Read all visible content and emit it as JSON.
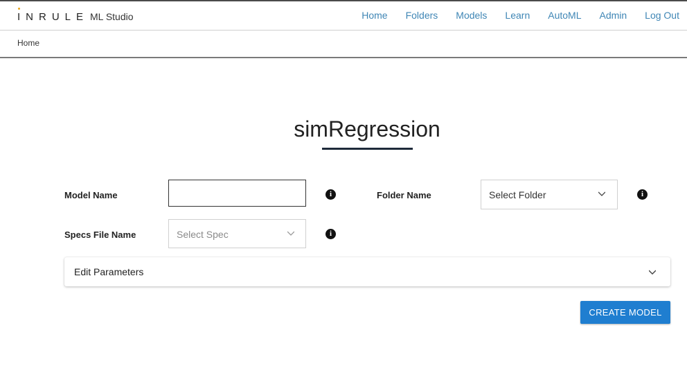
{
  "header": {
    "logo_mark": "INRULE",
    "logo_sub": "ML Studio",
    "nav": [
      "Home",
      "Folders",
      "Models",
      "Learn",
      "AutoML",
      "Admin",
      "Log Out"
    ],
    "nav_color": "#3f86b5",
    "logo_dot_color": "#e8a317"
  },
  "breadcrumb": {
    "home": "Home"
  },
  "page": {
    "title": "simRegression"
  },
  "form": {
    "model_name_label": "Model Name",
    "model_name_value": "",
    "folder_name_label": "Folder Name",
    "folder_select_value": "Select Folder",
    "specs_label": "Specs File Name",
    "specs_select_value": "Select Spec",
    "info_glyph": "i",
    "edit_params_label": "Edit Parameters",
    "create_button": "CREATE MODEL",
    "button_color": "#1f7ed0"
  }
}
